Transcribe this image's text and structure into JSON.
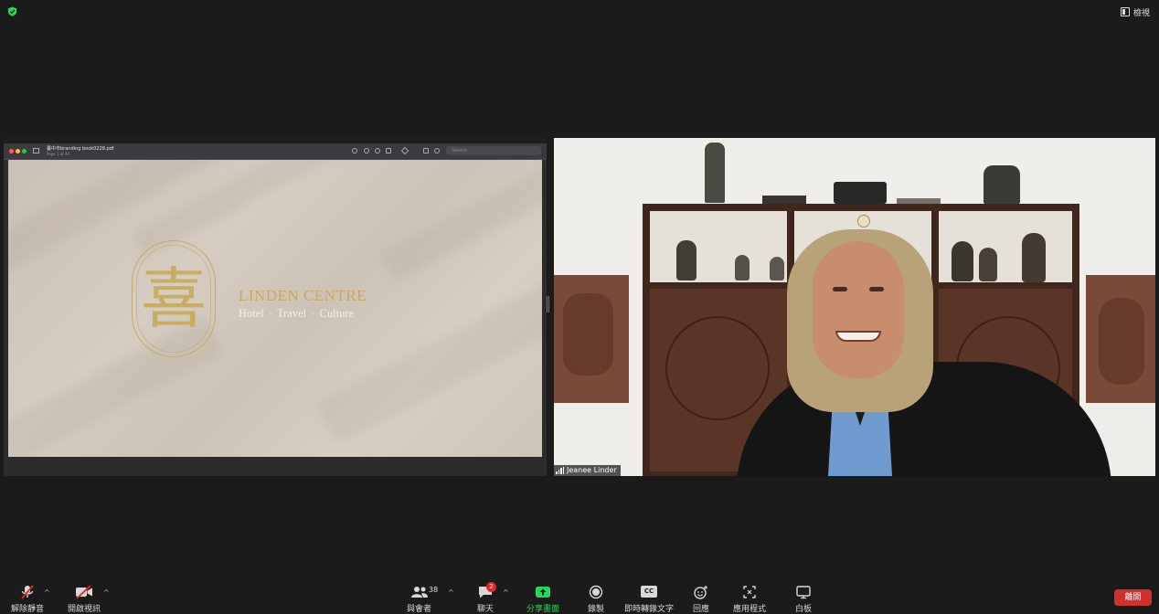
{
  "top_bar": {
    "view_label": "檢視"
  },
  "shared_screen": {
    "pdf_filename": "臺中市branding book0228.pdf",
    "pdf_page_info": "Page 1 of 40",
    "search_placeholder": "Search",
    "document": {
      "logo_character": "喜",
      "brand_name": "LINDEN CENTRE",
      "tagline": "Hotel  ·  Travel  ·  Culture"
    }
  },
  "video": {
    "participant_name": "Jeanee Linder"
  },
  "toolbar": {
    "unmute_label": "解除靜音",
    "start_video_label": "開啟視訊",
    "participants_label": "與會者",
    "participants_count": "38",
    "chat_label": "聊天",
    "chat_badge": "2",
    "share_label": "分享畫面",
    "record_label": "錄製",
    "captions_label": "即時轉錄文字",
    "captions_icon_text": "CC",
    "reactions_label": "回應",
    "apps_label": "應用程式",
    "whiteboard_label": "白板",
    "end_label": "離開"
  },
  "colors": {
    "background": "#1b1b1b",
    "share_green": "#23d959",
    "end_red": "#d0312d",
    "brand_gold": "#c7a961",
    "security_green": "#23d959"
  },
  "icons": [
    "shield-check-icon",
    "view-icon",
    "microphone-muted-icon",
    "video-off-icon",
    "participants-icon",
    "chat-icon",
    "share-screen-icon",
    "record-icon",
    "captions-icon",
    "reactions-icon",
    "apps-icon",
    "whiteboard-icon"
  ]
}
